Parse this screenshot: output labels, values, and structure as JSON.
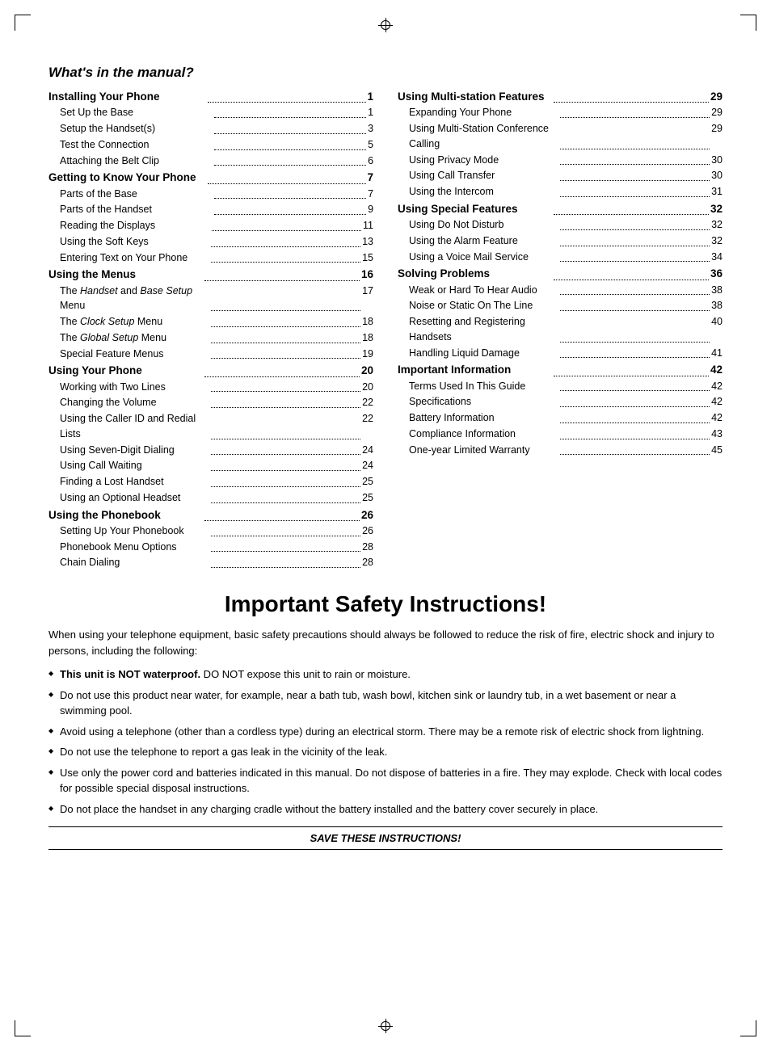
{
  "page": {
    "section_title": "What's in the manual?",
    "toc_left": [
      {
        "label": "Installing Your Phone",
        "page": "1",
        "main": true,
        "subs": [
          {
            "label": "Set Up the Base",
            "page": "1"
          },
          {
            "label": "Setup the Handset(s)",
            "page": "3"
          },
          {
            "label": "Test the Connection",
            "page": "5"
          },
          {
            "label": "Attaching the Belt Clip",
            "page": "6"
          }
        ]
      },
      {
        "label": "Getting to Know Your Phone",
        "page": "7",
        "main": true,
        "subs": [
          {
            "label": "Parts of the Base",
            "page": "7"
          },
          {
            "label": "Parts of the Handset",
            "page": "9"
          },
          {
            "label": "Reading the Displays",
            "page": "11"
          },
          {
            "label": "Using the Soft Keys",
            "page": "13"
          },
          {
            "label": "Entering Text on Your Phone",
            "page": "15"
          }
        ]
      },
      {
        "label": "Using the Menus",
        "page": "16",
        "main": true,
        "subs": [
          {
            "label": "The Handset and Base Setup Menu",
            "page": "17",
            "italic_part": "Handset and Base Setup"
          },
          {
            "label": "The Clock Setup Menu",
            "page": "18",
            "italic_part": "Clock Setup"
          },
          {
            "label": "The Global Setup Menu",
            "page": "18",
            "italic_part": "Global Setup"
          },
          {
            "label": "Special Feature Menus",
            "page": "19"
          }
        ]
      },
      {
        "label": "Using Your Phone",
        "page": "20",
        "main": true,
        "subs": [
          {
            "label": "Working with Two Lines",
            "page": "20"
          },
          {
            "label": "Changing the Volume",
            "page": "22"
          },
          {
            "label": "Using the Caller ID and Redial Lists",
            "page": "22"
          },
          {
            "label": "Using Seven-Digit Dialing",
            "page": "24"
          },
          {
            "label": "Using Call Waiting",
            "page": "24"
          },
          {
            "label": "Finding a Lost Handset",
            "page": "25"
          },
          {
            "label": "Using an Optional Headset",
            "page": "25"
          }
        ]
      },
      {
        "label": "Using the Phonebook",
        "page": "26",
        "main": true,
        "subs": [
          {
            "label": "Setting Up Your Phonebook",
            "page": "26"
          },
          {
            "label": "Phonebook Menu Options",
            "page": "28"
          },
          {
            "label": "Chain Dialing",
            "page": "28"
          }
        ]
      }
    ],
    "toc_right": [
      {
        "label": "Using Multi-station Features",
        "page": "29",
        "main": true,
        "subs": [
          {
            "label": "Expanding Your Phone",
            "page": "29"
          },
          {
            "label": "Using Multi-Station Conference Calling",
            "page": "29"
          },
          {
            "label": "Using Privacy Mode",
            "page": "30"
          },
          {
            "label": "Using Call Transfer",
            "page": "30"
          },
          {
            "label": "Using the Intercom",
            "page": "31"
          }
        ]
      },
      {
        "label": "Using Special Features",
        "page": "32",
        "main": true,
        "subs": [
          {
            "label": "Using Do Not Disturb",
            "page": "32"
          },
          {
            "label": "Using the Alarm Feature",
            "page": "32"
          },
          {
            "label": "Using a Voice Mail Service",
            "page": "34"
          }
        ]
      },
      {
        "label": "Solving Problems",
        "page": "36",
        "main": true,
        "subs": [
          {
            "label": "Weak or Hard To Hear Audio",
            "page": "38"
          },
          {
            "label": "Noise or Static On The Line",
            "page": "38"
          },
          {
            "label": "Resetting and Registering Handsets",
            "page": "40"
          },
          {
            "label": "Handling Liquid Damage",
            "page": "41"
          }
        ]
      },
      {
        "label": "Important Information",
        "page": "42",
        "main": true,
        "subs": [
          {
            "label": "Terms Used In This Guide",
            "page": "42"
          },
          {
            "label": "Specifications",
            "page": "42"
          },
          {
            "label": "Battery Information",
            "page": "42"
          },
          {
            "label": "Compliance Information",
            "page": "43"
          },
          {
            "label": "One-year Limited Warranty",
            "page": "45"
          }
        ]
      }
    ],
    "safety": {
      "title": "Important Safety Instructions!",
      "intro": "When using your telephone equipment, basic safety precautions should always be followed to reduce the risk of fire, electric shock and injury to persons, including the following:",
      "items": [
        {
          "bold_part": "This unit is NOT waterproof.",
          "rest": " DO NOT expose this unit to rain or moisture."
        },
        {
          "bold_part": "",
          "rest": "Do not use this product near water, for example, near a bath tub, wash bowl, kitchen sink or laundry tub, in a wet basement or near a swimming pool."
        },
        {
          "bold_part": "",
          "rest": "Avoid using a telephone (other than a cordless type) during an electrical storm. There may be a remote risk of electric shock from lightning."
        },
        {
          "bold_part": "",
          "rest": "Do not use the telephone to report a gas leak in the vicinity of the leak."
        },
        {
          "bold_part": "",
          "rest": "Use only the power cord and batteries indicated in this manual. Do not dispose of batteries in a fire. They may explode. Check with local codes for possible special disposal instructions."
        },
        {
          "bold_part": "",
          "rest": "Do not place the handset in any charging cradle without the battery installed and the battery cover securely in place."
        }
      ],
      "save_label": "SAVE THESE INSTRUCTIONS!"
    }
  }
}
